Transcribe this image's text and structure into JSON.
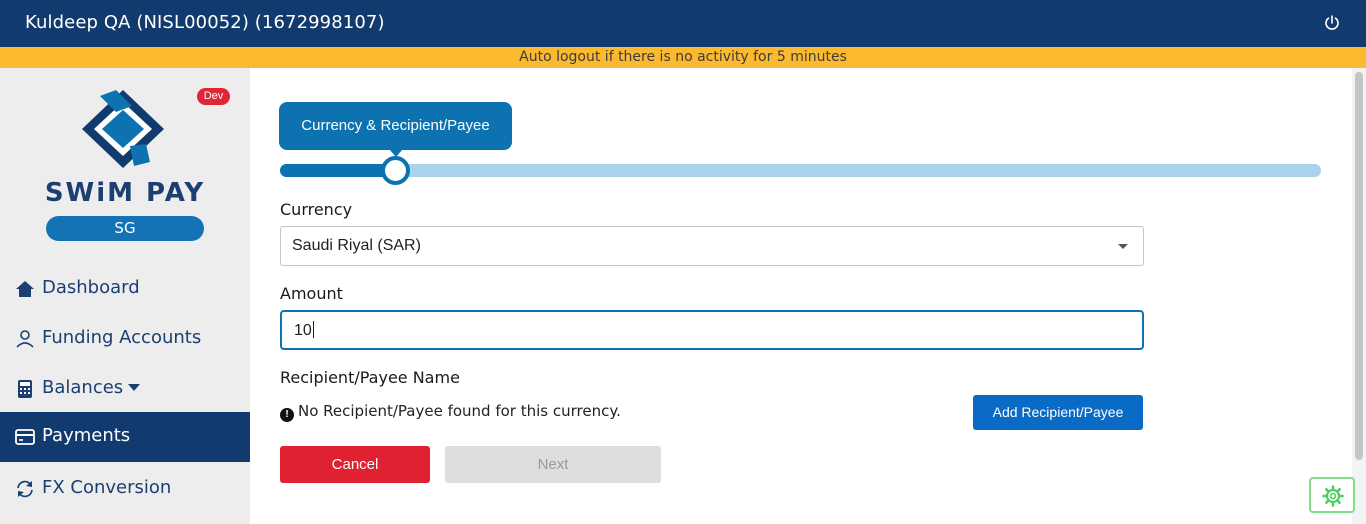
{
  "header": {
    "user_title": "Kuldeep QA (NISL00052) (1672998107)",
    "power_icon": "power-icon"
  },
  "banner": {
    "text": "Auto logout if there is no activity for 5 minutes"
  },
  "sidebar": {
    "badge": "Dev",
    "brand": "SWiM PAY",
    "region": "SG",
    "items": [
      {
        "label": "Dashboard",
        "icon": "home-icon"
      },
      {
        "label": "Funding Accounts",
        "icon": "user-icon"
      },
      {
        "label": "Balances",
        "icon": "calculator-icon"
      },
      {
        "label": "Payments",
        "icon": "credit-card-icon",
        "active": true
      },
      {
        "label": "FX Conversion",
        "icon": "refresh-icon"
      }
    ]
  },
  "stepper": {
    "current_step": "Currency & Recipient/Payee",
    "progress_fraction": 0.11
  },
  "form": {
    "currency_label": "Currency",
    "currency_value": "Saudi Riyal (SAR)",
    "amount_label": "Amount",
    "amount_value": "10",
    "recipient_label": "Recipient/Payee Name",
    "no_recipient_message": "No Recipient/Payee found for this currency.",
    "add_recipient_label": "Add Recipient/Payee",
    "cancel_label": "Cancel",
    "next_label": "Next"
  },
  "colors": {
    "navy": "#113b6e",
    "banner": "#fbb92f",
    "primary": "#0c73b0",
    "danger": "#e02131",
    "badge": "#e02737"
  }
}
